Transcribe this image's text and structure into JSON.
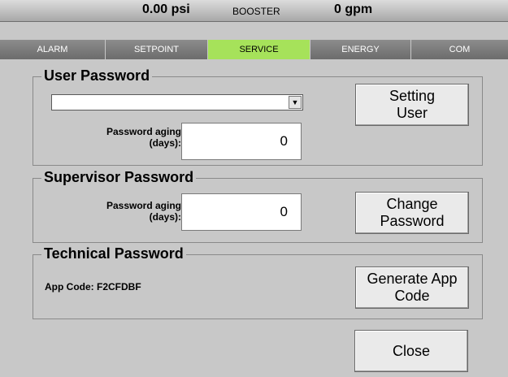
{
  "status": {
    "pressure": "0.00 psi",
    "mode": "BOOSTER",
    "flow": "0 gpm"
  },
  "tabs": [
    {
      "label": "ALARM"
    },
    {
      "label": "SETPOINT"
    },
    {
      "label": "SERVICE"
    },
    {
      "label": "ENERGY"
    },
    {
      "label": "COM"
    }
  ],
  "user_password": {
    "title": "User Password",
    "select_value": "",
    "aging_label": "Password aging\n(days):",
    "aging_value": "0",
    "button_label": "Setting\nUser"
  },
  "supervisor_password": {
    "title": "Supervisor Password",
    "aging_label": "Password aging\n(days):",
    "aging_value": "0",
    "button_label": "Change\nPassword"
  },
  "technical_password": {
    "title": "Technical Password",
    "app_code_label": "App Code:",
    "app_code_value": "F2CFDBF",
    "button_label": "Generate App\nCode"
  },
  "close_label": "Close",
  "colors": {
    "active_tab": "#a6e25a",
    "inactive_tab": "#7c7c7c",
    "background": "#c8c8c8"
  }
}
